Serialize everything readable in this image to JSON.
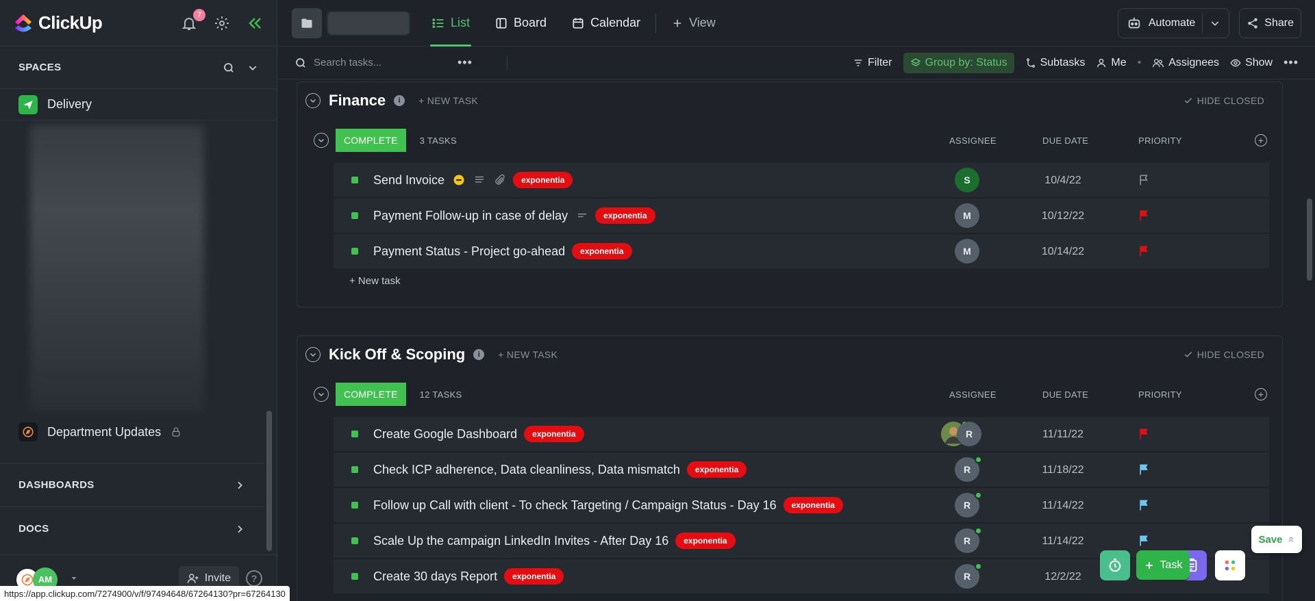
{
  "app": {
    "logo_text": "ClickUp",
    "notification_count": "7"
  },
  "sidebar": {
    "spaces_label": "SPACES",
    "space_item": "Delivery",
    "department_item": "Department Updates",
    "dashboards_label": "DASHBOARDS",
    "docs_label": "DOCS",
    "user_initials": "AM",
    "invite_label": "Invite",
    "help_label": "?"
  },
  "topbar": {
    "tabs": [
      {
        "label": "List",
        "icon": "list-icon",
        "active": true
      },
      {
        "label": "Board",
        "icon": "board-icon",
        "active": false
      },
      {
        "label": "Calendar",
        "icon": "calendar-icon",
        "active": false
      },
      {
        "label": "View",
        "icon": "plus-icon",
        "active": false
      }
    ],
    "automate_label": "Automate",
    "share_label": "Share"
  },
  "filterbar": {
    "search_placeholder": "Search tasks...",
    "filter_label": "Filter",
    "group_by_label": "Group by: Status",
    "subtasks_label": "Subtasks",
    "me_label": "Me",
    "assignees_label": "Assignees",
    "show_label": "Show"
  },
  "columns": {
    "assignee": "ASSIGNEE",
    "due_date": "DUE DATE",
    "priority": "PRIORITY"
  },
  "groups": [
    {
      "title": "Finance",
      "new_task_label": "+ NEW TASK",
      "hide_closed_label": "HIDE CLOSED",
      "status": "COMPLETE",
      "task_count": "3 TASKS",
      "add_task_label": "+ New task",
      "tasks": [
        {
          "name": "Send Invoice",
          "tag": "exponentia",
          "assignee": "S",
          "due": "10/4/22",
          "priority": "none"
        },
        {
          "name": "Payment Follow-up in case of delay",
          "tag": "exponentia",
          "assignee": "M",
          "due": "10/12/22",
          "priority": "urgent"
        },
        {
          "name": "Payment Status - Project go-ahead",
          "tag": "exponentia",
          "assignee": "M",
          "due": "10/14/22",
          "priority": "urgent"
        }
      ]
    },
    {
      "title": "Kick Off & Scoping",
      "new_task_label": "+ NEW TASK",
      "hide_closed_label": "HIDE CLOSED",
      "status": "COMPLETE",
      "task_count": "12 TASKS",
      "tasks": [
        {
          "name": "Create Google Dashboard",
          "tag": "exponentia",
          "assignee": "R",
          "due": "11/11/22",
          "priority": "urgent"
        },
        {
          "name": "Check ICP adherence, Data cleanliness, Data mismatch",
          "tag": "exponentia",
          "assignee": "R",
          "due": "11/18/22",
          "priority": "normal"
        },
        {
          "name": "Follow up Call with client - To check Targeting / Campaign Status - Day 16",
          "tag": "exponentia",
          "assignee": "R",
          "due": "11/14/22",
          "priority": "normal"
        },
        {
          "name": "Scale Up the campaign LinkedIn Invites - After Day 16",
          "tag": "exponentia",
          "assignee": "R",
          "due": "11/14/22",
          "priority": "normal"
        },
        {
          "name": "Create 30 days Report",
          "tag": "exponentia",
          "assignee": "R",
          "due": "12/2/22",
          "priority": "none"
        }
      ]
    }
  ],
  "floating": {
    "save_label": "Save",
    "task_label": "Task"
  },
  "status_url": "https://app.clickup.com/7274900/v/f/97494648/67264130?pr=67264130",
  "colors": {
    "accent_green": "#41c150",
    "tag_red": "#e40e12",
    "flag_urgent": "#e40e12",
    "flag_normal": "#6fc6f0"
  }
}
